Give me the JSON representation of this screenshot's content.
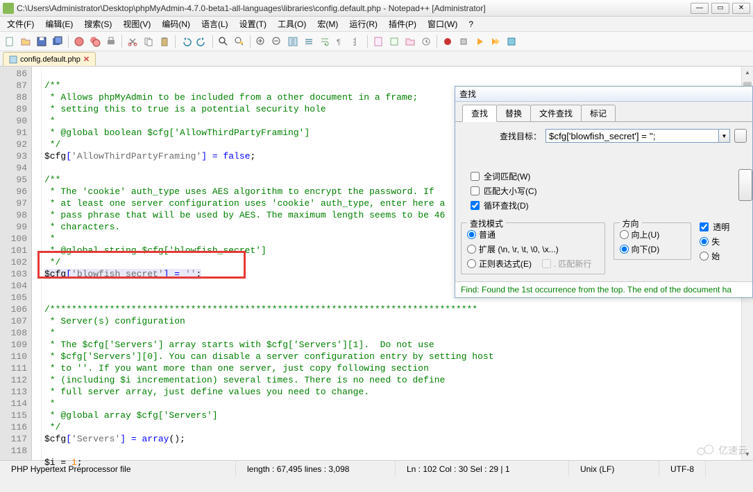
{
  "window": {
    "title": "C:\\Users\\Administrator\\Desktop\\phpMyAdmin-4.7.0-beta1-all-languages\\libraries\\config.default.php - Notepad++ [Administrator]",
    "minimize": "—",
    "maximize": "▭",
    "close": "✕"
  },
  "menu": {
    "file": "文件(F)",
    "edit": "编辑(E)",
    "search": "搜索(S)",
    "view": "视图(V)",
    "encoding": "编码(N)",
    "language": "语言(L)",
    "settings": "设置(T)",
    "tools": "工具(O)",
    "macro": "宏(M)",
    "run": "运行(R)",
    "plugins": "插件(P)",
    "window": "窗口(W)",
    "help": "?"
  },
  "tab": {
    "filename": "config.default.php",
    "close": "✕"
  },
  "gutter": {
    "start": 86,
    "end": 118
  },
  "code": {
    "l86": "/**",
    "l87": " * Allows phpMyAdmin to be included from a other document in a frame;",
    "l88": " * setting this to true is a potential security hole",
    "l89": " *",
    "l90": " * @global boolean $cfg['AllowThirdPartyFraming']",
    "l91": " */",
    "l92a": "$cfg",
    "l92b": "[",
    "l92c": "'AllowThirdPartyFraming'",
    "l92d": "] = ",
    "l92e": "false",
    "l92f": ";",
    "l93": "",
    "l94": "/**",
    "l95": " * The 'cookie' auth_type uses AES algorithm to encrypt the password. If",
    "l96": " * at least one server configuration uses 'cookie' auth_type, enter here a",
    "l97": " * pass phrase that will be used by AES. The maximum length seems to be 46",
    "l98": " * characters.",
    "l99": " *",
    "l100": " * @global string $cfg['blowfish_secret']",
    "l101": " */",
    "l102a": "$cfg",
    "l102b": "[",
    "l102c": "'blowfish_secret'",
    "l102d": "] = ",
    "l102e": "''",
    "l102f": ";",
    "l103": "",
    "l104": "",
    "l105": "/*******************************************************************************",
    "l106": " * Server(s) configuration",
    "l107": " *",
    "l108": " * The $cfg['Servers'] array starts with $cfg['Servers'][1].  Do not use",
    "l109": " * $cfg['Servers'][0]. You can disable a server configuration entry by setting host",
    "l110": " * to ''. If you want more than one server, just copy following section",
    "l111": " * (including $i incrementation) several times. There is no need to define",
    "l112": " * full server array, just define values you need to change.",
    "l113": " *",
    "l114": " * @global array $cfg['Servers']",
    "l115": " */",
    "l116a": "$cfg",
    "l116b": "[",
    "l116c": "'Servers'",
    "l116d": "] = ",
    "l116e": "array",
    "l116f": "();",
    "l117": "",
    "l118a": "$i",
    "l118b": " = ",
    "l118c": "1",
    "l118d": ";"
  },
  "find": {
    "title": "查找",
    "tabs": {
      "find": "查找",
      "replace": "替换",
      "findfiles": "文件查找",
      "mark": "标记"
    },
    "target_label": "查找目标：",
    "target_value": "$cfg['blowfish_secret'] = '';",
    "whole_word": "全词匹配(W)",
    "match_case": "匹配大小写(C)",
    "wrap": "循环查找(D)",
    "mode_title": "查找模式",
    "mode_normal": "普通",
    "mode_ext": "扩展 (\\n, \\r, \\t, \\0, \\x...)",
    "mode_regex": "正则表达式(E)",
    "mode_newline": ". 匹配新行",
    "dir_title": "方向",
    "dir_up": "向上(U)",
    "dir_down": "向下(D)",
    "transparent": "透明",
    "trans_opt1": "失",
    "trans_opt2": "始",
    "status": "Find: Found the 1st occurrence from the top. The end of the document ha"
  },
  "status": {
    "filetype": "PHP Hypertext Preprocessor file",
    "length": "length : 67,495    lines : 3,098",
    "pos": "Ln : 102    Col : 30    Sel : 29 | 1",
    "eol": "Unix (LF)",
    "enc": "UTF-8"
  },
  "watermark": "亿速云"
}
